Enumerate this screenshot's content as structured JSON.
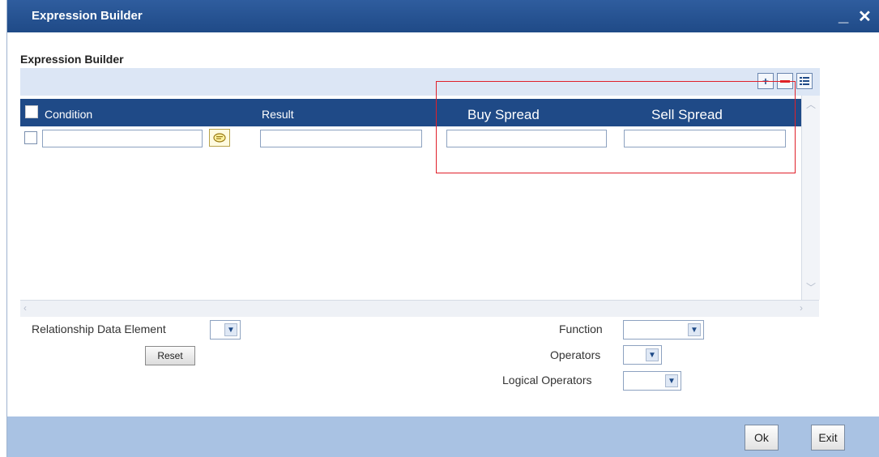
{
  "window": {
    "title": "Expression Builder",
    "minimize": "_",
    "close": "✕"
  },
  "section_label": "Expression Builder",
  "toolbar": {
    "add_icon": "plus-icon",
    "remove_icon": "minus-icon",
    "view_icon": "list-view-icon"
  },
  "grid": {
    "columns": [
      "Condition",
      "Result",
      "Buy Spread",
      "Sell Spread"
    ],
    "rows": [
      {
        "condition": "",
        "result": "",
        "buy_spread": "",
        "sell_spread": ""
      }
    ]
  },
  "form": {
    "relationship_label": "Relationship Data Element",
    "reset_label": "Reset",
    "function_label": "Function",
    "operators_label": "Operators",
    "logical_operators_label": "Logical Operators"
  },
  "footer": {
    "ok_label": "Ok",
    "exit_label": "Exit"
  },
  "colors": {
    "titlebar": "#1f4a87",
    "header": "#1f4a87",
    "footer": "#a9c2e3",
    "highlight": "#e0202a"
  }
}
